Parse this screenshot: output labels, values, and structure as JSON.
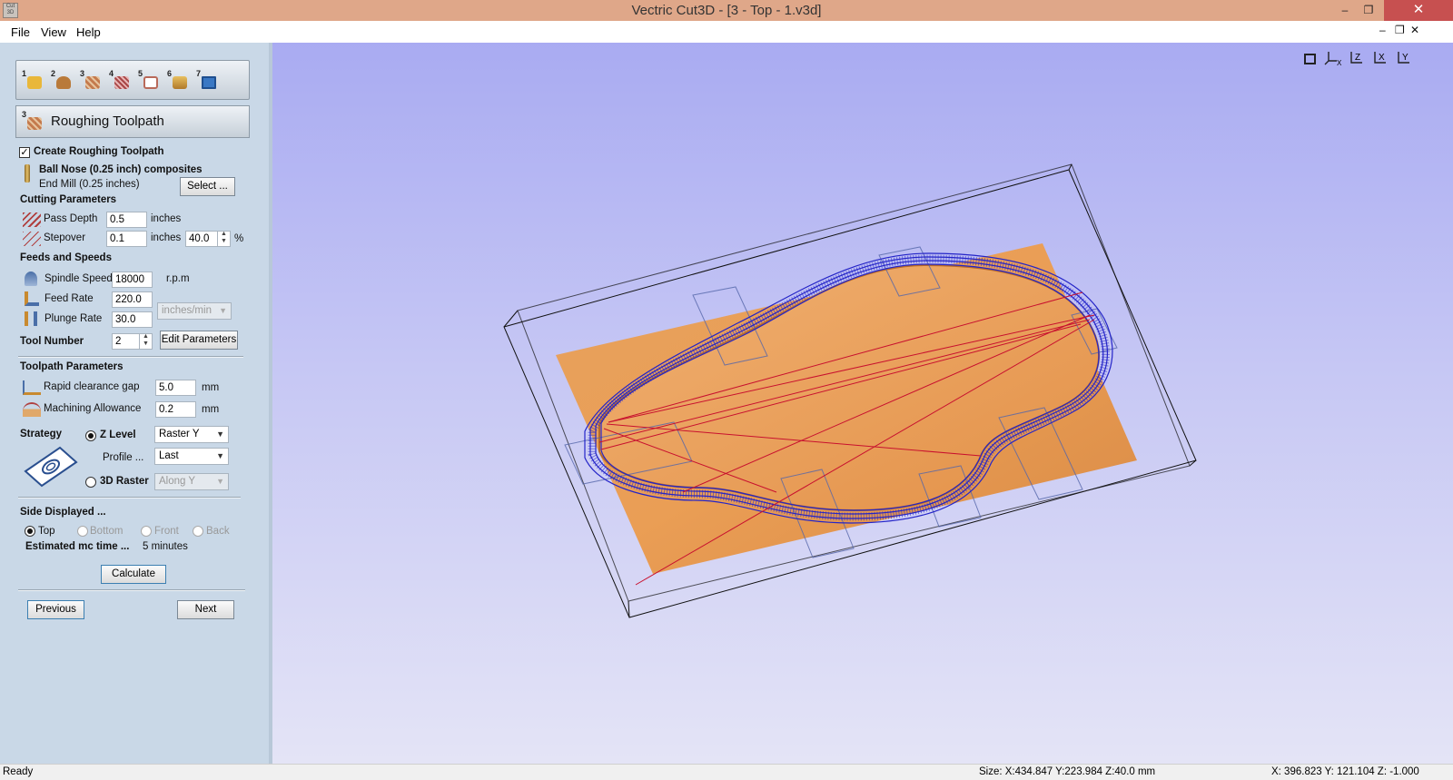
{
  "window": {
    "title": "Vectric Cut3D - [3 - Top - 1.v3d]",
    "minimize_glyph": "–",
    "restore_glyph": "❐",
    "close_glyph": "✕"
  },
  "menu": {
    "items": [
      {
        "label": "File",
        "hotkey": "F"
      },
      {
        "label": "View",
        "hotkey": "V"
      },
      {
        "label": "Help",
        "hotkey": "H"
      }
    ],
    "mdi_minimize": "–",
    "mdi_restore": "❐",
    "mdi_close": "✕"
  },
  "steps": [
    {
      "num": "1",
      "icon": "open-folder-icon",
      "color": "#e9b73a"
    },
    {
      "num": "2",
      "icon": "orient-model-icon",
      "color": "#b97a3a"
    },
    {
      "num": "3",
      "icon": "roughing-toolpath-icon",
      "color": "#c47a4d"
    },
    {
      "num": "4",
      "icon": "finishing-toolpath-icon",
      "color": "#a84747"
    },
    {
      "num": "5",
      "icon": "cutout-toolpath-icon",
      "color": "#b96a5a"
    },
    {
      "num": "6",
      "icon": "preview-toolpath-icon",
      "color": "#d09a3a"
    },
    {
      "num": "7",
      "icon": "save-toolpath-icon",
      "color": "#3a78c4"
    }
  ],
  "panel": {
    "title": "Roughing Toolpath",
    "create_label": "Create Roughing Toolpath",
    "create_checked": "✓",
    "tool_name": "Ball Nose (0.25 inch) composites",
    "tool_desc": "End Mill (0.25 inches)",
    "select_btn": "Select ...",
    "cutting_params": "Cutting Parameters",
    "pass_depth_label": "Pass Depth",
    "pass_depth": "0.5",
    "pass_depth_unit": "inches",
    "stepover_label": "Stepover",
    "stepover": "0.1",
    "stepover_unit": "inches",
    "stepover_pct": "40.0",
    "pct": "%",
    "feeds": "Feeds and Speeds",
    "spindle_label": "Spindle Speed",
    "spindle": "18000",
    "spindle_unit": "r.p.m",
    "feed_label": "Feed Rate",
    "feed": "220.0",
    "plunge_label": "Plunge Rate",
    "plunge": "30.0",
    "rate_unit": "inches/min",
    "tool_number_label": "Tool Number",
    "tool_number": "2",
    "edit_params": "Edit Parameters",
    "toolpath_params": "Toolpath Parameters",
    "rapid_label": "Rapid clearance gap",
    "rapid": "5.0",
    "rapid_unit": "mm",
    "allowance_label": "Machining Allowance",
    "allowance": "0.2",
    "allowance_unit": "mm",
    "strategy_label": "Strategy",
    "zlevel_label": "Z Level",
    "zlevel_select": "Raster Y",
    "profile_label": "Profile ...",
    "profile_select": "Last",
    "raster_label": "3D Raster",
    "raster_select": "Along Y",
    "side_label": "Side Displayed ...",
    "sides": [
      "Top",
      "Bottom",
      "Front",
      "Back"
    ],
    "est_label": "Estimated mc time ...",
    "est_value": "5 minutes",
    "calculate": "Calculate",
    "previous": "Previous",
    "next": "Next"
  },
  "view_icons": [
    {
      "name": "fit-view-icon",
      "label": ""
    },
    {
      "name": "iso-view-icon",
      "label": "X"
    },
    {
      "name": "view-z-icon",
      "label": "Z"
    },
    {
      "name": "view-x-icon",
      "label": "X"
    },
    {
      "name": "view-y-icon",
      "label": "Y"
    }
  ],
  "status": {
    "ready": "Ready",
    "size": "Size: X:434.847 Y:223.984 Z:40.0 mm",
    "coords": "X: 396.823 Y: 121.104 Z:  -1.000"
  },
  "colors": {
    "titlebar": "#dfa789",
    "panel": "#c9d8e7",
    "wood": "#e49a55",
    "toolpath_blue": "#2424c8",
    "rapid_red": "#c8102e"
  }
}
